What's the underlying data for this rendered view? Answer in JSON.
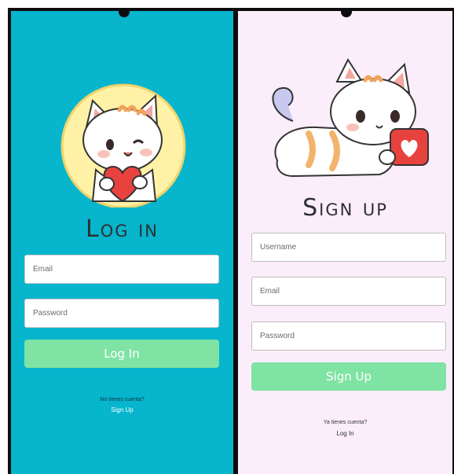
{
  "login": {
    "title": "Log in",
    "email_placeholder": "Email",
    "password_placeholder": "Password",
    "button_label": "Log In",
    "prompt": "No tienes cuenta?",
    "link_label": "Sign Up",
    "colors": {
      "background": "#07b5cd",
      "button": "#7fe3a3",
      "avatar_circle": "#fff1a6"
    }
  },
  "signup": {
    "title": "Sign up",
    "username_placeholder": "Username",
    "email_placeholder": "Email",
    "password_placeholder": "Password",
    "button_label": "Sign Up",
    "prompt": "Ya tienes cuenta?",
    "link_label": "Log In",
    "colors": {
      "background": "#fbeefa",
      "button": "#7fe3a3"
    }
  },
  "icons": {
    "login_mascot": "cat-holding-heart-icon",
    "signup_mascot": "cat-with-heart-card-icon"
  }
}
